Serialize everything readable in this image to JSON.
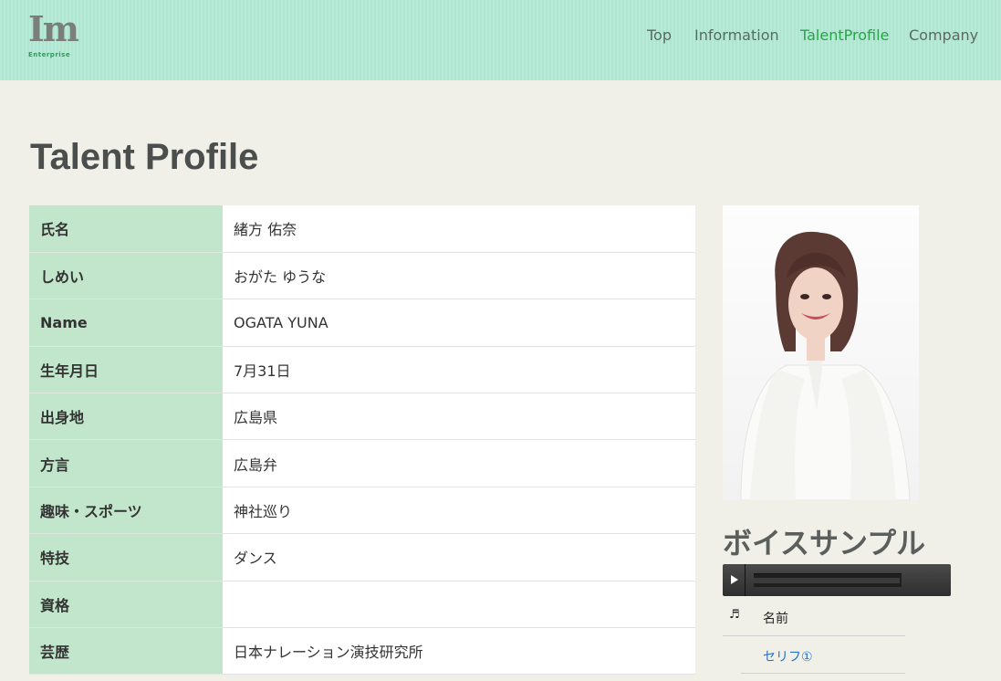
{
  "logo": {
    "mark": "Im",
    "text": "Enterprise"
  },
  "nav": [
    {
      "label": "Top",
      "active": false
    },
    {
      "label": "Information",
      "active": false
    },
    {
      "label": "TalentProfile",
      "active": true
    },
    {
      "label": "Company",
      "active": false
    }
  ],
  "page": {
    "title": "Talent Profile"
  },
  "profile": [
    {
      "label": "氏名",
      "value": "緒方 佑奈"
    },
    {
      "label": "しめい",
      "value": "おがた ゆうな"
    },
    {
      "label": "Name",
      "value": "OGATA YUNA"
    },
    {
      "label": "生年月日",
      "value": "7月31日"
    },
    {
      "label": "出身地",
      "value": "広島県"
    },
    {
      "label": "方言",
      "value": "広島弁"
    },
    {
      "label": "趣味・スポーツ",
      "value": "神社巡り"
    },
    {
      "label": "特技",
      "value": "ダンス"
    },
    {
      "label": "資格",
      "value": ""
    },
    {
      "label": "芸歴",
      "value": "日本ナレーション演技研究所"
    }
  ],
  "voice": {
    "title": "ボイスサンプル",
    "player": {
      "progress": 0.99
    },
    "tracklist": {
      "header_icon": "music-note-icon",
      "header_label": "名前",
      "items": [
        "セリフ①"
      ]
    }
  },
  "colors": {
    "header_bg": "#b3ead5",
    "nav_active": "#2aa34a",
    "label_bg": "#c2e6cb",
    "link": "#2673c9"
  }
}
